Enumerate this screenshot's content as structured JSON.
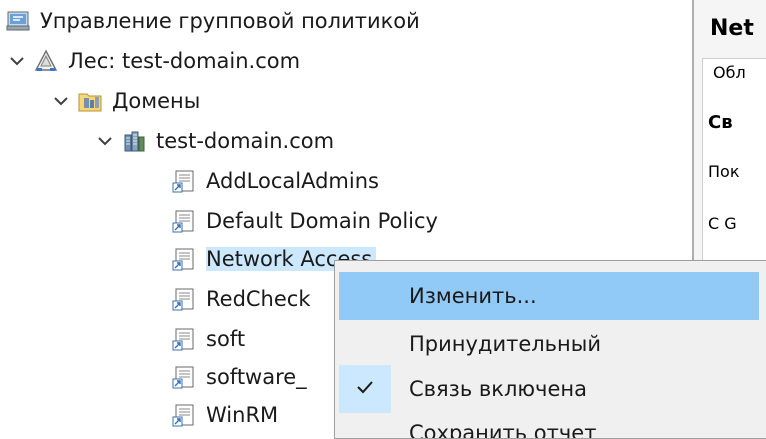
{
  "tree": {
    "root": "Управление групповой политикой",
    "forest": "Лес: test-domain.com",
    "domains": "Домены",
    "domain": "test-domain.com",
    "gpos": [
      "AddLocalAdmins",
      "Default Domain Policy",
      "Network Access",
      "RedCheck",
      "soft",
      "software_",
      "WinRM"
    ]
  },
  "right_panel": {
    "title": "Net",
    "tab": "Обл",
    "heading": "Св",
    "line1": "Пок",
    "line2": "C G"
  },
  "context_menu": {
    "items": [
      "Изменить...",
      "Принудительный",
      "Связь включена",
      "Сохранить отчет"
    ]
  },
  "colors": {
    "selection": "#cce8ff",
    "menu_highlight": "#91c9f7",
    "menu_bg": "#f0f0f0"
  }
}
